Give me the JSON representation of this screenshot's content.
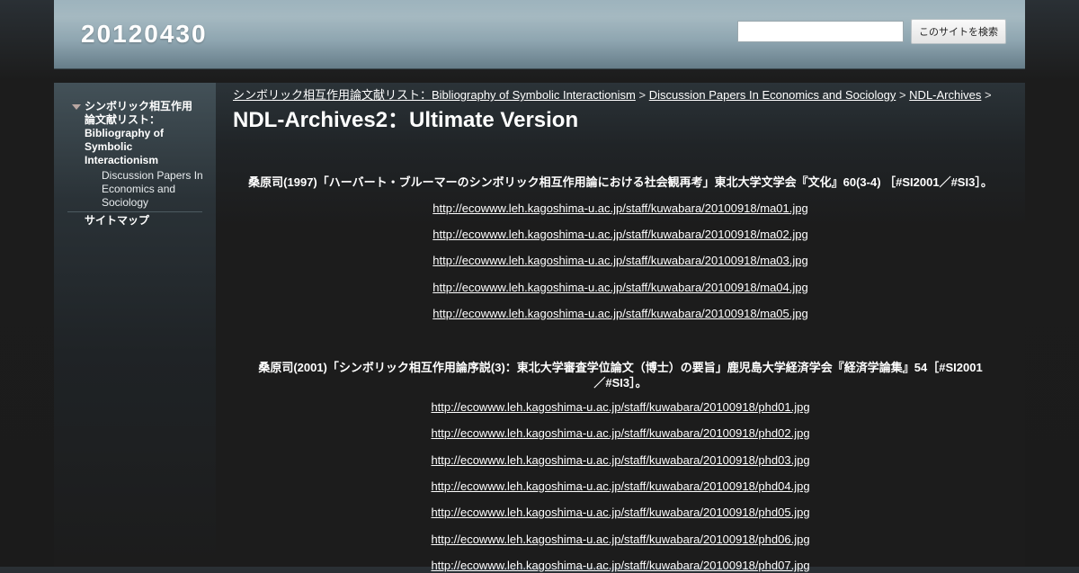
{
  "header": {
    "site_title": "20120430",
    "search_placeholder": "",
    "search_button_label": "このサイトを検索"
  },
  "sidebar": {
    "items": [
      {
        "label": "シンボリック相互作用論文献リスト：Bibliography of Symbolic Interactionism",
        "expanded": true,
        "icon": "triangle-down-icon"
      },
      {
        "label": "Discussion Papers In Economics and Sociology",
        "level": 2
      },
      {
        "label": "サイトマップ"
      }
    ]
  },
  "breadcrumb": {
    "items": [
      "シンボリック相互作用論文献リスト：Bibliography of Symbolic Interactionism",
      "Discussion Papers In Economics and Sociology",
      "NDL-Archives"
    ],
    "separator": ">"
  },
  "page": {
    "title": "NDL-Archives2：Ultimate Version"
  },
  "entries": [
    {
      "citation": "桑原司(1997)「ハーバート・ブルーマーのシンボリック相互作用論における社会観再考」東北大学文学会『文化』60(3-4) ［#SI2001／#SI3］。",
      "links": [
        "http://ecowww.leh.kagoshima-u.ac.jp/staff/kuwabara/20100918/ma01.jpg",
        "http://ecowww.leh.kagoshima-u.ac.jp/staff/kuwabara/20100918/ma02.jpg",
        "http://ecowww.leh.kagoshima-u.ac.jp/staff/kuwabara/20100918/ma03.jpg",
        "http://ecowww.leh.kagoshima-u.ac.jp/staff/kuwabara/20100918/ma04.jpg",
        "http://ecowww.leh.kagoshima-u.ac.jp/staff/kuwabara/20100918/ma05.jpg"
      ]
    },
    {
      "citation": "桑原司(2001)「シンボリック相互作用論序説(3)：東北大学審査学位論文（博士）の要旨」鹿児島大学経済学会『経済学論集』54［#SI2001／#SI3］。",
      "links": [
        "http://ecowww.leh.kagoshima-u.ac.jp/staff/kuwabara/20100918/phd01.jpg",
        "http://ecowww.leh.kagoshima-u.ac.jp/staff/kuwabara/20100918/phd02.jpg",
        "http://ecowww.leh.kagoshima-u.ac.jp/staff/kuwabara/20100918/phd03.jpg",
        "http://ecowww.leh.kagoshima-u.ac.jp/staff/kuwabara/20100918/phd04.jpg",
        "http://ecowww.leh.kagoshima-u.ac.jp/staff/kuwabara/20100918/phd05.jpg",
        "http://ecowww.leh.kagoshima-u.ac.jp/staff/kuwabara/20100918/phd06.jpg",
        "http://ecowww.leh.kagoshima-u.ac.jp/staff/kuwabara/20100918/phd07.jpg"
      ]
    }
  ],
  "colors": {
    "header_accent": "#9db3bd",
    "page_background": "#1b1b1b",
    "text": "#ffffff"
  }
}
